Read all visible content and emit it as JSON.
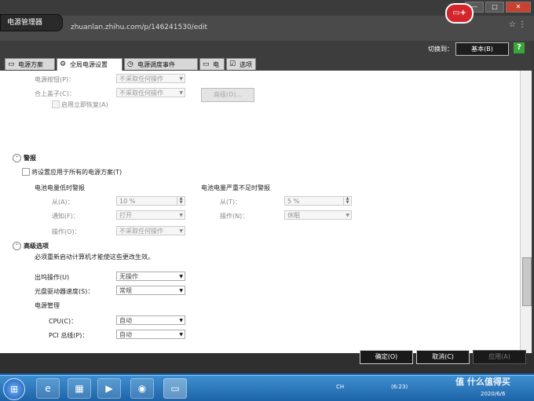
{
  "browser": {
    "window_title": "电源管理器",
    "url": "zhuanlan.zhihu.com/p/146241530/edit",
    "window_controls": [
      "—",
      "□",
      "✕"
    ]
  },
  "app": {
    "switch_label": "切换到：",
    "switch_value": "基本(B)",
    "help": "?",
    "tabs": [
      {
        "label": "电源方案",
        "icon": "battery-plan-icon"
      },
      {
        "label": "全局电源设置",
        "icon": "gear-icon"
      },
      {
        "label": "电源调度事件",
        "icon": "schedule-icon"
      },
      {
        "label": "电池",
        "icon": "battery-icon"
      },
      {
        "label": "选项",
        "icon": "options-icon"
      }
    ],
    "active_tab": 1
  },
  "general": {
    "power_button_label": "电源按钮(P)：",
    "power_button_value": "不采取任何操作",
    "lid_label": "合上盖子(C)：",
    "lid_value": "不采取任何操作",
    "advanced_button": "高级(D)...",
    "instant_resume_label": "启用立即恢复(A)"
  },
  "alarm": {
    "section_title": "警报",
    "apply_all_label": "将设置应用于所有的电源方案(T)",
    "low_title": "电池电量低时警报",
    "low_from_label": "从(A)：",
    "low_from_value": "10 %",
    "low_notify_label": "通知(F)：",
    "low_notify_value": "打开",
    "low_action_label": "操作(O)：",
    "low_action_value": "不采取任何操作",
    "critical_title": "电池电量严重不足时警报",
    "critical_from_label": "从(T)：",
    "critical_from_value": "5 %",
    "critical_action_label": "操作(N)：",
    "critical_action_value": "休眠"
  },
  "advanced": {
    "section_title": "高级选项",
    "note": "必须重新启动计算机才能使这些更改生效。",
    "dock_label": "出坞操作(U)",
    "dock_value": "无操作",
    "optical_label": "光盘驱动器速度(S)：",
    "optical_value": "常规",
    "power_mgmt_title": "电源管理",
    "cpu_label": "CPU(C)：",
    "cpu_value": "自动",
    "pci_label": "PCI 总线(P)：",
    "pci_value": "自动"
  },
  "dialog": {
    "ok": "确定(O)",
    "cancel": "取消(C)",
    "apply": "应用(A)"
  },
  "taskbar": {
    "start": "⊞",
    "tray_lang": "CH",
    "tray_time_bubble": "(6:23)",
    "clock_date": "2020/6/6",
    "watermark": "值 什么值得买"
  }
}
